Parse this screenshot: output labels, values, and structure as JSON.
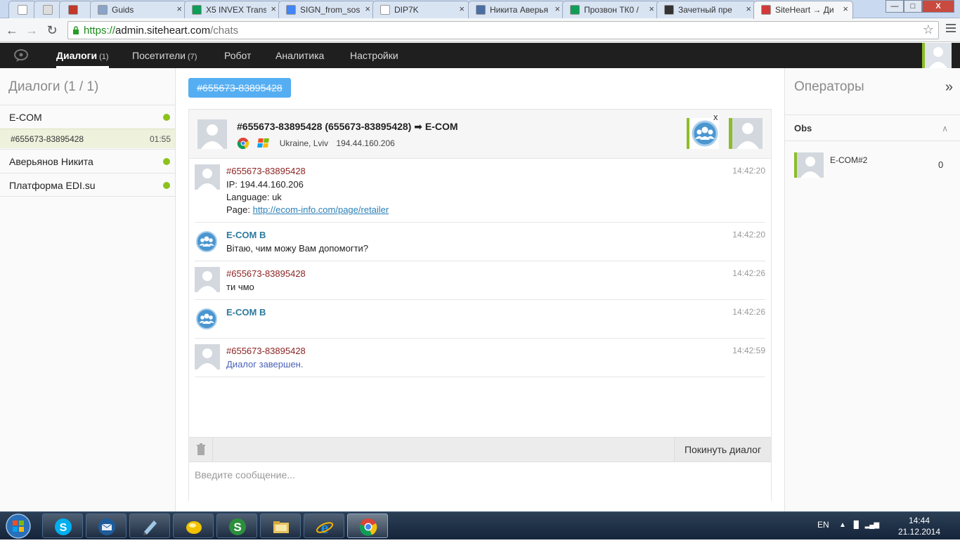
{
  "browser": {
    "tabs": [
      {
        "title": "",
        "favicon": "blank-page-icon",
        "active": false
      },
      {
        "title": "",
        "favicon": "spiral-icon",
        "active": false
      },
      {
        "title": "",
        "favicon": "red-logo-icon",
        "active": false
      },
      {
        "title": "Guids",
        "favicon": "image-icon",
        "active": false
      },
      {
        "title": "X5 INVEX Trans",
        "favicon": "sheets-icon",
        "active": false
      },
      {
        "title": "SIGN_from_sos",
        "favicon": "docs-icon",
        "active": false
      },
      {
        "title": "DIP7K",
        "favicon": "blank-page-icon",
        "active": false
      },
      {
        "title": "Никита Аверья",
        "favicon": "pause-icon",
        "active": false
      },
      {
        "title": "Прозвон ТК0 /",
        "favicon": "sheets-icon",
        "active": false
      },
      {
        "title": "Зачетный пре",
        "favicon": "face-icon",
        "active": false
      },
      {
        "title": "SiteHeart → Ди",
        "favicon": "siteheart-icon",
        "active": true
      }
    ],
    "url_scheme": "https://",
    "url_host": "admin.siteheart.com",
    "url_path": "/chats"
  },
  "nav": {
    "items": [
      {
        "label": "Диалоги",
        "count": "(1)",
        "active": true
      },
      {
        "label": "Посетители",
        "count": "(7)",
        "active": false
      },
      {
        "label": "Робот",
        "count": "",
        "active": false
      },
      {
        "label": "Аналитика",
        "count": "",
        "active": false
      },
      {
        "label": "Настройки",
        "count": "",
        "active": false
      }
    ]
  },
  "left": {
    "title": "Диалоги  (1 / 1)",
    "groups": [
      {
        "label": "E-COM",
        "status": "online"
      },
      {
        "label": "Аверьянов Никита",
        "status": "online"
      },
      {
        "label": "Платформа EDI.su",
        "status": "online"
      }
    ],
    "active_dialog": {
      "id": "#655673-83895428",
      "duration": "01:55"
    }
  },
  "center": {
    "dialog_tag": "#655673-83895428",
    "header": {
      "title": "#655673-83895428 (655673-83895428) ➡ E-COM",
      "location": "Ukraine, Lviv",
      "ip": "194.44.160.206",
      "close_label": "x"
    },
    "messages": [
      {
        "author": "#655673-83895428",
        "role": "visitor",
        "time": "14:42:20",
        "lines": [
          "IP: 194.44.160.206",
          "Language: uk"
        ],
        "page_label": "Page: ",
        "page_link": "http://ecom-info.com/page/retailer"
      },
      {
        "author": "E-COM B",
        "role": "operator",
        "time": "14:42:20",
        "lines": [
          "Вітаю, чим можу Вам допомогти?"
        ]
      },
      {
        "author": "#655673-83895428",
        "role": "visitor",
        "time": "14:42:26",
        "lines": [
          "ти чмо"
        ]
      },
      {
        "author": "E-COM B",
        "role": "operator",
        "time": "14:42:26",
        "lines": []
      },
      {
        "author": "#655673-83895428",
        "role": "visitor",
        "time": "14:42:59",
        "lines": [
          "Диалог завершен."
        ],
        "system": true
      }
    ],
    "leave_button": "Покинуть диалог",
    "input_placeholder": "Введите сообщение..."
  },
  "right": {
    "title": "Операторы",
    "group": "Obs",
    "operator": {
      "name": "E-COM#2",
      "count": "0"
    }
  },
  "taskbar": {
    "apps": [
      "skype-icon",
      "thunderbird-icon",
      "notepad-icon",
      "sun-icon",
      "s-app-icon",
      "explorer-icon",
      "ie-icon",
      "chrome-icon"
    ],
    "lang": "EN",
    "time": "14:44",
    "date": "21.12.2014"
  },
  "colors": {
    "nav_bg": "#1f1f1f",
    "accent_blue": "#55aef2",
    "online_green": "#8cc21e",
    "visitor_name": "#8b2323",
    "operator_name": "#2d7a9e"
  }
}
